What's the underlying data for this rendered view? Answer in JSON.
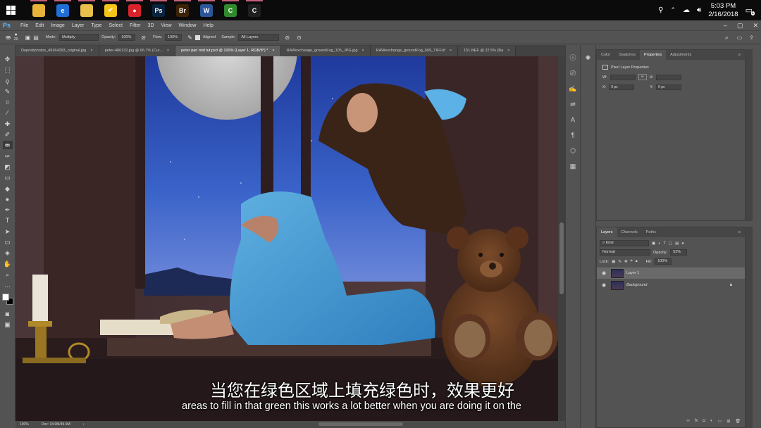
{
  "taskbar": {
    "apps": [
      {
        "name": "chrome-icon",
        "glyph": "",
        "color": "#e8b33a"
      },
      {
        "name": "edge-icon",
        "glyph": "e",
        "color": "#1f6fd6"
      },
      {
        "name": "file-explorer-icon",
        "glyph": "",
        "color": "#e6c04b"
      },
      {
        "name": "norton-icon",
        "glyph": "✔",
        "color": "#f5c518"
      },
      {
        "name": "screencast-icon",
        "glyph": "●",
        "color": "#d8232a"
      },
      {
        "name": "photoshop-icon",
        "glyph": "Ps",
        "color": "#0a2440"
      },
      {
        "name": "bridge-icon",
        "glyph": "Br",
        "color": "#3b2205"
      },
      {
        "name": "word-icon",
        "glyph": "W",
        "color": "#2b579a"
      },
      {
        "name": "camtasia-green-icon",
        "glyph": "C",
        "color": "#2f8a2c"
      },
      {
        "name": "camtasia-icon",
        "glyph": "C",
        "color": "#1f1f1f"
      }
    ],
    "time": "5:03 PM",
    "date": "2/16/2018",
    "tray_badge": "1"
  },
  "menubar": {
    "logo": "Ps",
    "items": [
      "File",
      "Edit",
      "Image",
      "Layer",
      "Type",
      "Select",
      "Filter",
      "3D",
      "View",
      "Window",
      "Help"
    ]
  },
  "options": {
    "brush_size": "20",
    "mode_label": "Mode:",
    "mode_value": "Multiply",
    "opacity_label": "Opacity:",
    "opacity_value": "100%",
    "flow_label": "Flow:",
    "flow_value": "100%",
    "aligned_label": "Aligned",
    "sample_label": "Sample:",
    "sample_value": "All Layers"
  },
  "doc_tabs": [
    {
      "label": "Depositphotos_49364393_original.jpg",
      "active": false
    },
    {
      "label": "peter-486132.jpg @ 66.7% (Cur...",
      "active": false
    },
    {
      "label": "peter pan mid tut.psd @ 100% (Layer 1, RGB/8*) *",
      "active": true
    },
    {
      "label": "RAWexchange_groundFog_105_JPG.jpg",
      "active": false
    },
    {
      "label": "RAWexchange_groundFog_609_TIFF.tif",
      "active": false
    },
    {
      "label": "151.NEF @ 22.5% (Ba",
      "active": false
    }
  ],
  "canvas": {
    "subtitle_cn": "当您在绿色区域上填充绿色时，效果更好",
    "subtitle_en": "areas to fill in that green this works a lot better when you are doing it on the"
  },
  "status": {
    "zoom": "100%",
    "doc": "Doc: 34.9M/49.9M"
  },
  "properties_panel": {
    "tabs": [
      "Color",
      "Swatches",
      "Properties",
      "Adjustments"
    ],
    "active_tab": "Properties",
    "title": "Pixel Layer Properties",
    "w_label": "W:",
    "h_label": "H:",
    "x_label": "X:",
    "x_value": "0 px",
    "y_label": "Y:",
    "y_value": "0 px"
  },
  "layers_panel": {
    "tabs": [
      "Layers",
      "Channels",
      "Paths"
    ],
    "active_tab": "Layers",
    "filter_kind": "Kind",
    "blend_mode": "Normal",
    "opacity_label": "Opacity:",
    "opacity_value": "52%",
    "lock_label": "Lock:",
    "fill_label": "Fill:",
    "fill_value": "100%",
    "layers": [
      {
        "name": "Layer 1",
        "selected": true,
        "locked": false
      },
      {
        "name": "Background",
        "selected": false,
        "locked": true
      }
    ],
    "bottom_icons": [
      "link-icon",
      "fx-icon",
      "mask-icon",
      "adjustment-icon",
      "group-icon",
      "new-layer-icon",
      "trash-icon"
    ]
  },
  "colors": {
    "ui_bg": "#535353",
    "panel_dark": "#464646",
    "ps_blue": "#5eb8ff"
  }
}
